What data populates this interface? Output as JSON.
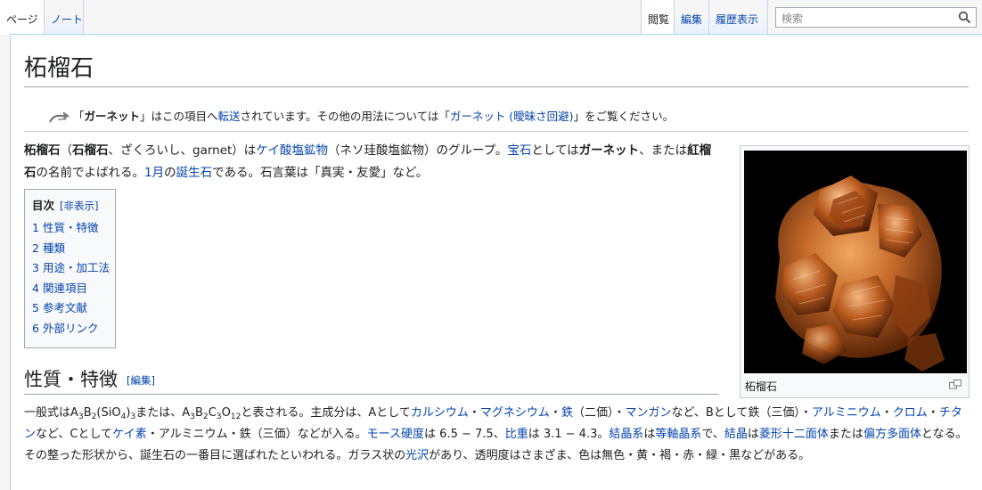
{
  "tabs": {
    "left": [
      {
        "label": "ページ",
        "selected": true
      },
      {
        "label": "ノート",
        "selected": false
      }
    ],
    "right": [
      {
        "label": "閲覧",
        "selected": true
      },
      {
        "label": "編集",
        "selected": false
      },
      {
        "label": "履歴表示",
        "selected": false
      }
    ]
  },
  "search": {
    "placeholder": "検索",
    "icon": "search-icon"
  },
  "page": {
    "title": "柘榴石"
  },
  "hatnote": {
    "q1": "「",
    "term": "ガーネット",
    "t1": "」はこの項目へ",
    "link_redirect": "転送",
    "t2": "されています。その他の用法については「",
    "link_disambig": "ガーネット (曖昧さ回避)",
    "t3": "」をご覧ください。"
  },
  "intro": {
    "s1": "柘榴石",
    "s2": "（",
    "s3": "石榴石",
    "s4": "、ざくろいし、garnet）は",
    "l1": "ケイ酸塩鉱物",
    "s5": "（ネソ珪酸塩鉱物）のグループ。",
    "l2": "宝石",
    "s6": "としては",
    "s7": "ガーネット",
    "s8": "、または",
    "s9": "紅榴石",
    "s10": "の名前でよばれる。",
    "l3": "1月",
    "s11": "の",
    "l4": "誕生石",
    "s12": "である。石言葉は「真実・友愛」など。"
  },
  "toc": {
    "title": "目次",
    "toggle": "[非表示]",
    "items": [
      {
        "num": "1",
        "label": "性質・特徴"
      },
      {
        "num": "2",
        "label": "種類"
      },
      {
        "num": "3",
        "label": "用途・加工法"
      },
      {
        "num": "4",
        "label": "関連項目"
      },
      {
        "num": "5",
        "label": "参考文献"
      },
      {
        "num": "6",
        "label": "外部リンク"
      }
    ]
  },
  "figure": {
    "caption": "柘榴石"
  },
  "section1": {
    "heading": "性質・特徴",
    "edit": "[編集]",
    "p": {
      "a1": "一般式はA",
      "sub1": "3",
      "a2": "B",
      "sub2": "2",
      "a3": "(SiO",
      "sub3": "4",
      "a4": ")",
      "sub4": "3",
      "a5": "または、A",
      "sub5": "3",
      "a6": "B",
      "sub6": "2",
      "a7": "C",
      "sub7": "3",
      "a8": "O",
      "sub8": "12",
      "a9": "と表される。主成分は、Aとして",
      "l1": "カルシウム",
      "d1": "・",
      "l2": "マグネシウム",
      "d2": "・",
      "l3": "鉄",
      "a10": "（二価）・",
      "l4": "マンガン",
      "a11": "など、Bとして鉄（三価）・",
      "l5": "アルミニウム",
      "d3": "・",
      "l6": "クロム",
      "d4": "・",
      "l7": "チタン",
      "a12": "など、Cとして",
      "l8": "ケイ素",
      "a13": "・アルミニウム・鉄（三価）などが入る。",
      "l9": "モース硬度",
      "a14": "は 6.5 − 7.5、",
      "l10": "比重",
      "a15": "は 3.1 − 4.3。",
      "l11": "結晶系",
      "a16": "は",
      "l12": "等軸晶系",
      "a17": "で、",
      "l13": "結晶",
      "a18": "は",
      "l14": "菱形十二面体",
      "a19": "または",
      "l15": "偏方多面体",
      "a20": "となる。その整った形状から、誕生石の一番目に選ばれたといわれる。ガラス状の",
      "l16": "光沢",
      "a21": "があり、透明度はさまざま、色は無色・黄・褐・赤・緑・黒などがある。"
    }
  }
}
